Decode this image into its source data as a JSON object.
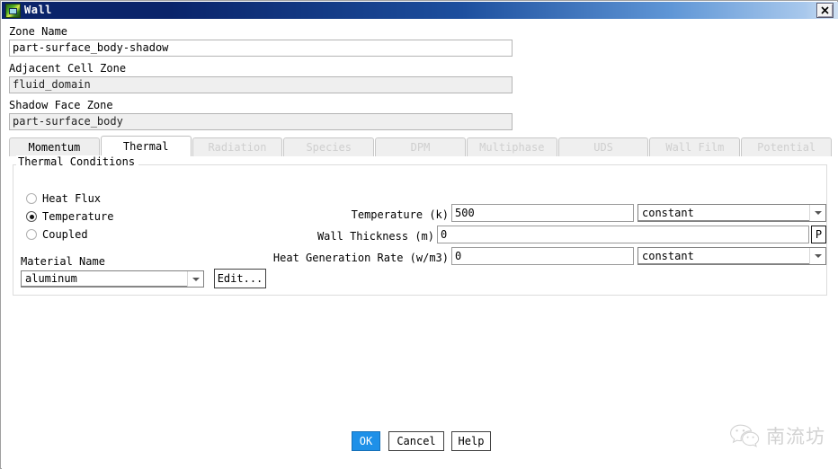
{
  "window": {
    "title": "Wall",
    "icon": "fluent-wall-icon",
    "close_label": "close-icon"
  },
  "fields": {
    "zone_name": {
      "label": "Zone Name",
      "value": "part-surface_body-shadow"
    },
    "adjacent_cell_zone": {
      "label": "Adjacent Cell Zone",
      "value": "fluid_domain"
    },
    "shadow_face_zone": {
      "label": "Shadow Face Zone",
      "value": "part-surface_body"
    }
  },
  "tabs": [
    {
      "label": "Momentum",
      "state": "enabled"
    },
    {
      "label": "Thermal",
      "state": "selected"
    },
    {
      "label": "Radiation",
      "state": "disabled"
    },
    {
      "label": "Species",
      "state": "disabled"
    },
    {
      "label": "DPM",
      "state": "disabled"
    },
    {
      "label": "Multiphase",
      "state": "disabled"
    },
    {
      "label": "UDS",
      "state": "disabled"
    },
    {
      "label": "Wall Film",
      "state": "disabled"
    },
    {
      "label": "Potential",
      "state": "disabled"
    }
  ],
  "thermal": {
    "group_title": "Thermal Conditions",
    "conditions": [
      {
        "label": "Heat Flux",
        "selected": false
      },
      {
        "label": "Temperature",
        "selected": true
      },
      {
        "label": "Coupled",
        "selected": false
      }
    ],
    "material": {
      "label": "Material Name",
      "value": "aluminum",
      "edit_label": "Edit..."
    },
    "temperature": {
      "label": "Temperature (k)",
      "value": "500",
      "profile": "constant"
    },
    "wall_thickness": {
      "label": "Wall Thickness (m)",
      "value": "0",
      "param_button": "P"
    },
    "heat_generation_rate": {
      "label": "Heat Generation Rate (w/m3)",
      "value": "0",
      "profile": "constant"
    }
  },
  "footer": {
    "ok_label": "OK",
    "cancel_label": "Cancel",
    "help_label": "Help"
  },
  "watermark": {
    "text": "南流坊",
    "logo": "wechat-icon"
  },
  "colors": {
    "title_bar_start": "#0a246a",
    "title_bar_end": "#cfe0f2",
    "accent_ok": "#1e90e8",
    "disabled_text": "#cfcfcf",
    "readonly_field": "#efefef"
  }
}
